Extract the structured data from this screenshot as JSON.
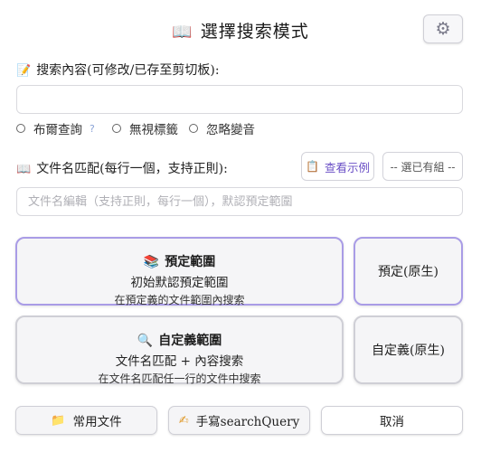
{
  "header": {
    "title": "選擇搜索模式",
    "title_icon": "book-icon",
    "settings_icon": "gear-icon"
  },
  "search": {
    "label": "搜索內容(可修改/已存至剪切板):",
    "label_icon": "memo-icon",
    "value": "",
    "placeholder": ""
  },
  "options": {
    "boolean_query": "布爾查詢",
    "help": "?",
    "ignore_tags": "無視標籤",
    "ignore_tones": "忽略變音"
  },
  "filename": {
    "label": "文件名匹配(每行一個，支持正則):",
    "label_icon": "book-icon",
    "example_button": "查看示例",
    "example_icon": "clipboard-icon",
    "group_select": "-- 選已有組 --",
    "placeholder": "文件名編輯（支持正則，每行一個），默認預定範圍"
  },
  "modes": {
    "preset": {
      "title": "預定範圍",
      "icon": "books-icon",
      "subtitle": "初始默認預定範圍",
      "description": "在預定義的文件範圍內搜索"
    },
    "preset_native": "預定(原生)",
    "custom": {
      "title": "自定義範圍",
      "icon": "magnifier-icon",
      "subtitle": "文件名匹配 + 內容搜索",
      "description": "在文件名匹配任一行的文件中搜索"
    },
    "custom_native": "自定義(原生)"
  },
  "footer": {
    "common_files": "常用文件",
    "common_files_icon": "folder-icon",
    "manual_query": "手寫searchQuery",
    "manual_query_icon": "writing-hand-icon",
    "cancel": "取消"
  },
  "colors": {
    "selected_border": "#a99ce6",
    "accent_text": "#6a4fc6"
  }
}
